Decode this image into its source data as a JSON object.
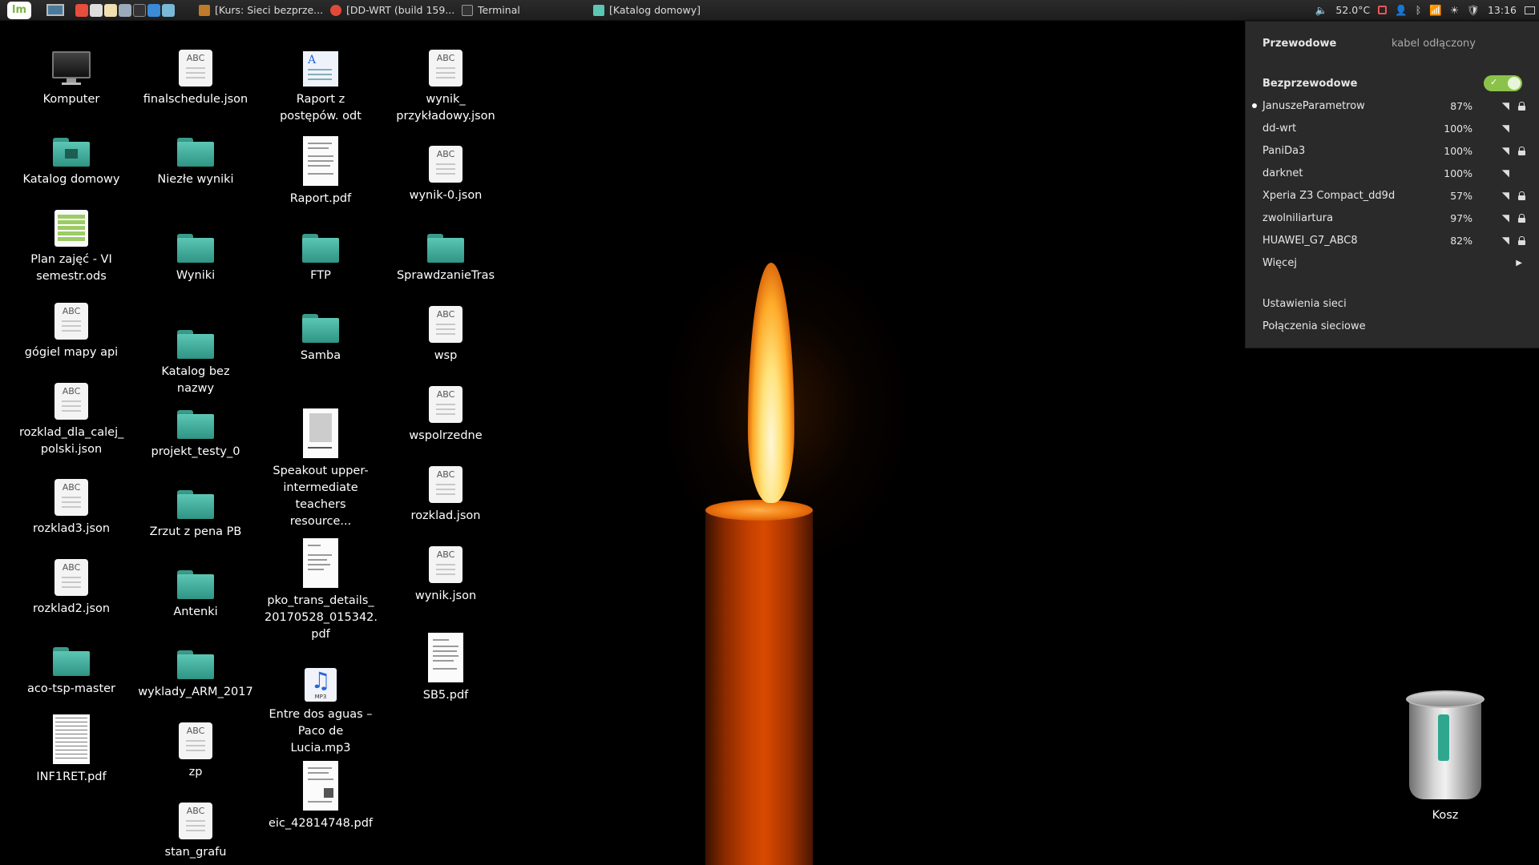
{
  "panel": {
    "menu_logo": "lm",
    "tasks": [
      {
        "label": "[Kurs: Sieci bezprze...",
        "icon": "book-icon",
        "color": "#c07a2a"
      },
      {
        "label": "[DD-WRT (build 159...",
        "icon": "chrome-icon",
        "color": "#e04a3a"
      },
      {
        "label": "Terminal",
        "icon": "terminal-icon",
        "color": "#444"
      },
      {
        "label": "[Katalog domowy]",
        "icon": "folder-icon",
        "color": "#5cc6b4"
      }
    ],
    "tray": {
      "temperature": "52.0°C",
      "clock": "13:16"
    }
  },
  "desktop": {
    "icons": {
      "komputer": "Komputer",
      "katalog_domowy": "Katalog domowy",
      "plan_zajec": "Plan zajęć - VI semestr.ods",
      "gogiel": "gógiel mapy api",
      "rozklad_dla_calej": "rozklad_dla_calej_ polski.json",
      "rozklad3": "rozklad3.json",
      "rozklad2": "rozklad2.json",
      "aco": "aco-tsp-master",
      "inf1ret": "INF1RET.pdf",
      "finalschedule": "finalschedule.json",
      "niezle": "Niezłe wyniki",
      "wyniki": "Wyniki",
      "katalog_bez": "Katalog bez nazwy",
      "projekt": "projekt_testy_0",
      "zrzut": "Zrzut z pena PB",
      "antenki": "Antenki",
      "wyklady": "wyklady_ARM_2017",
      "zp": "zp",
      "stan_grafu": "stan_grafu",
      "raport_odt": "Raport z postępów. odt",
      "raport_pdf": "Raport.pdf",
      "ftp": "FTP",
      "samba": "Samba",
      "speakout": "Speakout upper-intermediate teachers resource...",
      "pko": "pko_trans_details_ 20170528_015342. pdf",
      "entre": "Entre dos aguas – Paco de Lucia.mp3",
      "eic": "eic_42814748.pdf",
      "wynik_przyk": "wynik_ przykładowy.json",
      "wynik0": "wynik-0.json",
      "sprawdzanie": "SprawdzanieTras",
      "wsp": "wsp",
      "wspolrzedne": "wspolrzedne",
      "rozklad_json": "rozklad.json",
      "wynik_json": "wynik.json",
      "sb5": "SB5.pdf",
      "kosz": "Kosz",
      "abc": "ABC",
      "mp3_tag": "MP3"
    }
  },
  "network_menu": {
    "wired_label": "Przewodowe",
    "wired_status": "kabel odłączony",
    "wireless_label": "Bezprzewodowe",
    "wireless_enabled": true,
    "networks": [
      {
        "name": "JanuszeParametrow",
        "signal": "87%",
        "secured": true,
        "connected": true
      },
      {
        "name": "dd-wrt",
        "signal": "100%",
        "secured": false,
        "connected": false
      },
      {
        "name": "PaniDa3",
        "signal": "100%",
        "secured": true,
        "connected": false
      },
      {
        "name": "darknet",
        "signal": "100%",
        "secured": false,
        "connected": false
      },
      {
        "name": "Xperia Z3 Compact_dd9d",
        "signal": "57%",
        "secured": true,
        "connected": false
      },
      {
        "name": "zwolniliartura",
        "signal": "97%",
        "secured": true,
        "connected": false
      },
      {
        "name": "HUAWEI_G7_ABC8",
        "signal": "82%",
        "secured": true,
        "connected": false
      }
    ],
    "more_label": "Więcej",
    "settings_label": "Ustawienia sieci",
    "connections_label": "Połączenia sieciowe"
  }
}
